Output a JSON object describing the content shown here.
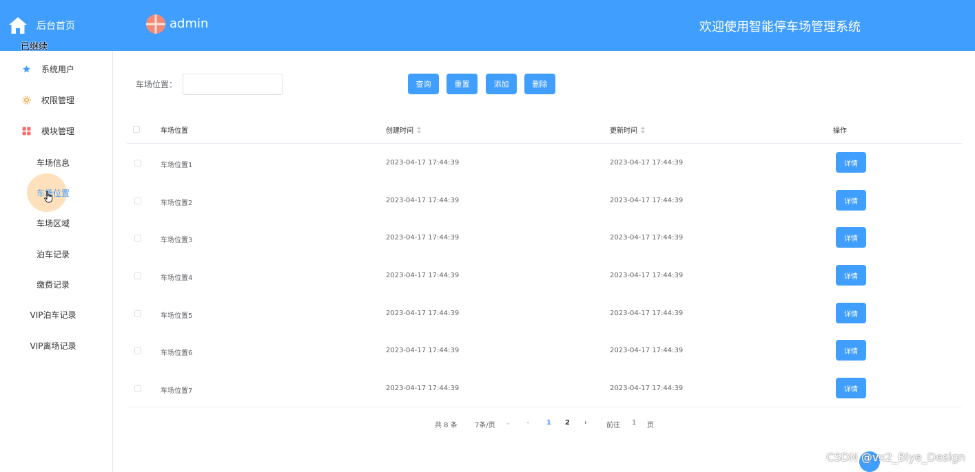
{
  "brand": {
    "title": "后台首页",
    "overlay": "已继续"
  },
  "header": {
    "user": "admin",
    "title": "欢迎使用智能停车场管理系统"
  },
  "sidebar": {
    "menus": [
      {
        "label": "系统用户",
        "icon": "star-icon",
        "color": "#409eff"
      },
      {
        "label": "权限管理",
        "icon": "gear-icon",
        "color": "#e6a23c"
      },
      {
        "label": "模块管理",
        "icon": "grid-icon",
        "color": "#f56c6c"
      }
    ],
    "subs": [
      {
        "label": "车场信息"
      },
      {
        "label": "车场位置",
        "active": true
      },
      {
        "label": "车场区域"
      },
      {
        "label": "泊车记录"
      },
      {
        "label": "缴费记录"
      },
      {
        "label": "VIP泊车记录"
      },
      {
        "label": "VIP离场记录"
      }
    ]
  },
  "search": {
    "label": "车场位置：",
    "value": ""
  },
  "buttons": {
    "query": "查询",
    "reset": "重置",
    "add": "添加",
    "delete": "删除"
  },
  "table": {
    "headers": {
      "position": "车场位置",
      "created": "创建时间",
      "updated": "更新时间",
      "action": "操作"
    },
    "detail_label": "详情",
    "rows": [
      {
        "position": "车场位置1",
        "created": "2023-04-17 17:44:39",
        "updated": "2023-04-17 17:44:39"
      },
      {
        "position": "车场位置2",
        "created": "2023-04-17 17:44:39",
        "updated": "2023-04-17 17:44:39"
      },
      {
        "position": "车场位置3",
        "created": "2023-04-17 17:44:39",
        "updated": "2023-04-17 17:44:39"
      },
      {
        "position": "车场位置4",
        "created": "2023-04-17 17:44:39",
        "updated": "2023-04-17 17:44:39"
      },
      {
        "position": "车场位置5",
        "created": "2023-04-17 17:44:39",
        "updated": "2023-04-17 17:44:39"
      },
      {
        "position": "车场位置6",
        "created": "2023-04-17 17:44:39",
        "updated": "2023-04-17 17:44:39"
      },
      {
        "position": "车场位置7",
        "created": "2023-04-17 17:44:39",
        "updated": "2023-04-17 17:44:39"
      }
    ]
  },
  "pager": {
    "total": "共 8 条",
    "page_size": "7条/页",
    "pages": [
      "1",
      "2"
    ],
    "current": "1",
    "goto_label": "前往",
    "goto_value": "1",
    "page_unit": "页"
  },
  "watermark": "CSDN @vx2_Biye_Design"
}
